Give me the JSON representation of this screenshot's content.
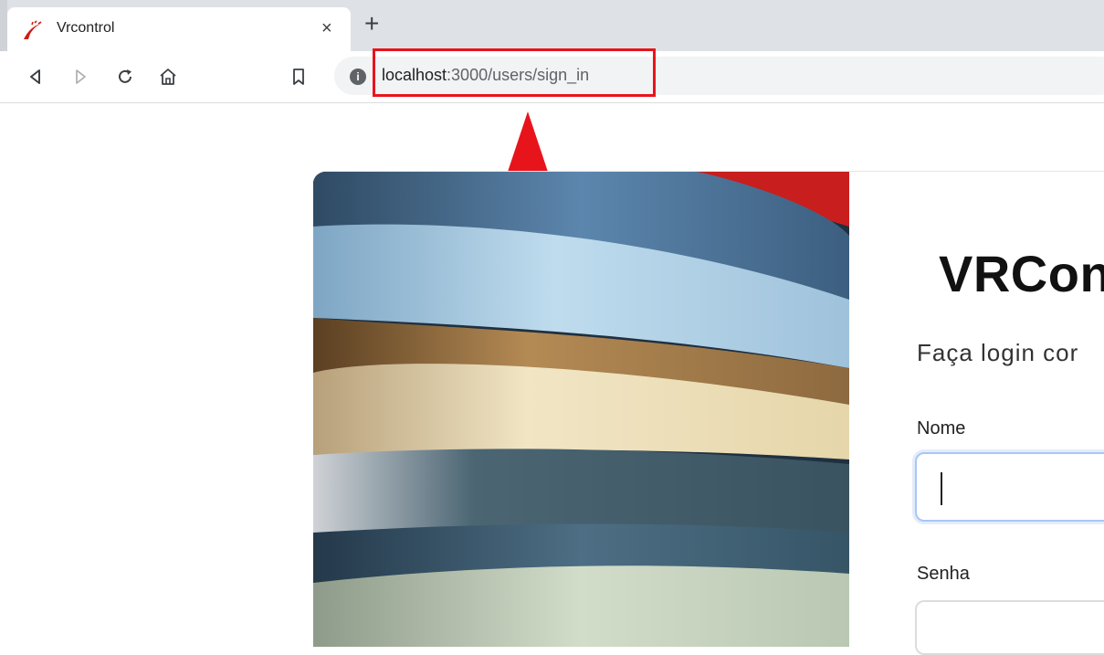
{
  "browser": {
    "tab": {
      "title": "Vrcontrol",
      "close_glyph": "×"
    },
    "new_tab_glyph": "+",
    "address_bar": {
      "host": "localhost",
      "path": ":3000/users/sign_in",
      "info_glyph": "i"
    },
    "icons": [
      "back-icon",
      "forward-icon",
      "reload-icon",
      "home-icon",
      "bookmark-icon",
      "site-info-icon"
    ]
  },
  "annotation": {
    "highlight_color": "#e8141c"
  },
  "login": {
    "brand": "VRCon",
    "subtitle": "Faça login cor",
    "fields": {
      "name_label": "Nome",
      "name_value": "",
      "password_label": "Senha",
      "password_value": ""
    }
  }
}
